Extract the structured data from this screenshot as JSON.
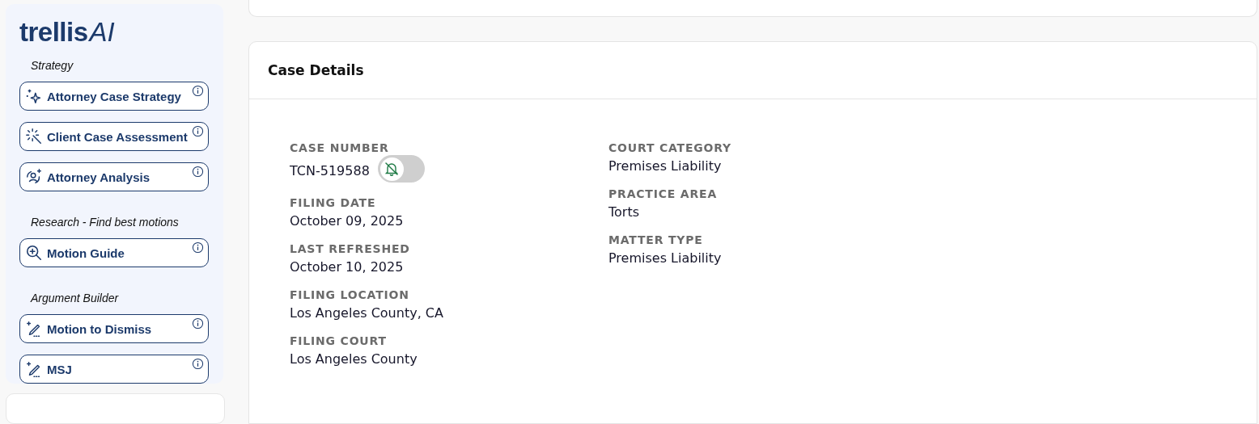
{
  "logo": {
    "wordmark": "trellis",
    "suffix": "AI"
  },
  "sidebar": {
    "groups": [
      {
        "heading": "Strategy",
        "items": [
          {
            "label": "Attorney Case Strategy",
            "kind": "sparkle"
          },
          {
            "label": "Client Case Assessment",
            "kind": "wand"
          },
          {
            "label": "Attorney Analysis",
            "kind": "person"
          }
        ]
      },
      {
        "heading": "Research - Find best motions",
        "items": [
          {
            "label": "Motion Guide",
            "kind": "search"
          }
        ]
      },
      {
        "heading": "Argument Builder",
        "items": [
          {
            "label": "Motion to Dismiss",
            "kind": "pen"
          },
          {
            "label": "MSJ",
            "kind": "pen"
          }
        ]
      }
    ]
  },
  "case_details": {
    "title": "Case Details",
    "columns": [
      [
        {
          "label": "CASE NUMBER",
          "value": "TCN-519588",
          "notifications_on": false
        },
        {
          "label": "FILING DATE",
          "value": "October 09, 2025"
        },
        {
          "label": "LAST REFRESHED",
          "value": "October 10, 2025"
        },
        {
          "label": "FILING LOCATION",
          "value": "Los Angeles County, CA"
        },
        {
          "label": "FILING COURT",
          "value": "Los Angeles County"
        }
      ],
      [
        {
          "label": "COURT CATEGORY",
          "value": "Premises Liability"
        },
        {
          "label": "PRACTICE AREA",
          "value": "Torts"
        },
        {
          "label": "MATTER TYPE",
          "value": "Premises Liability"
        }
      ]
    ]
  }
}
